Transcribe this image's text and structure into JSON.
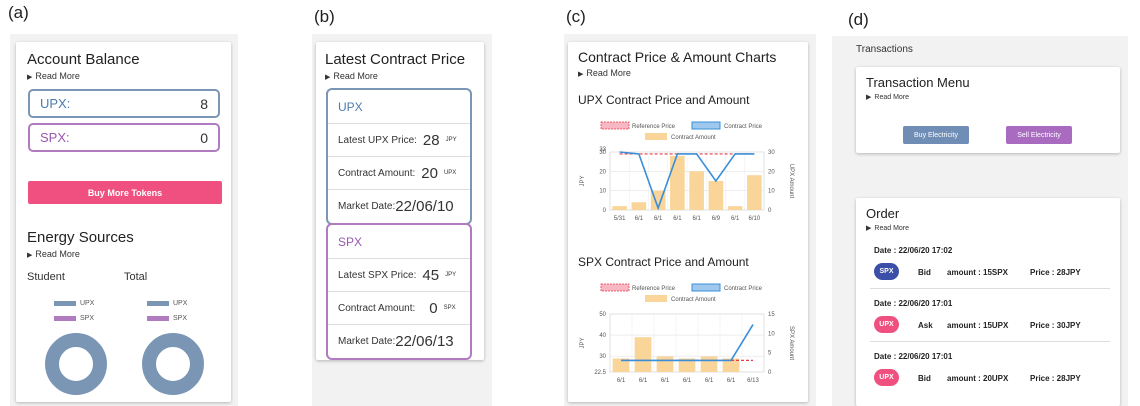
{
  "labels": {
    "a": "(a)",
    "b": "(b)",
    "c": "(c)",
    "d": "(d)"
  },
  "read_more": "Read More",
  "colors": {
    "upx": "#7b96b5",
    "spx": "#b07bc0",
    "pink": "#f0507f",
    "bar": "#f9d59a",
    "ref_line": "#e83a4a",
    "price_line": "#3a8fd8"
  },
  "panel_a": {
    "title": "Account Balance",
    "upx": {
      "name": "UPX:",
      "value": "8"
    },
    "spx": {
      "name": "SPX:",
      "value": "0"
    },
    "buy_button": "Buy More Tokens",
    "energy_title": "Energy Sources",
    "student_label": "Student",
    "total_label": "Total",
    "legend": {
      "upx": "UPX",
      "spx": "SPX"
    }
  },
  "panel_b": {
    "title": "Latest Contract Price",
    "upx": {
      "header": "UPX",
      "price_label": "Latest UPX Price:",
      "price_value": "28",
      "price_unit": "JPY",
      "amount_label": "Contract Amount:",
      "amount_value": "20",
      "amount_unit": "UPX",
      "date_label": "Market Date:",
      "date_value": "22/06/10"
    },
    "spx": {
      "header": "SPX",
      "price_label": "Latest SPX Price:",
      "price_value": "45",
      "price_unit": "JPY",
      "amount_label": "Contract Amount:",
      "amount_value": "0",
      "amount_unit": "SPX",
      "date_label": "Market Date:",
      "date_value": "22/06/13"
    }
  },
  "panel_c": {
    "title": "Contract Price & Amount Charts",
    "upx_chart_title": "UPX Contract Price and Amount",
    "spx_chart_title": "SPX Contract Price and Amount"
  },
  "chart_data": [
    {
      "type": "bar",
      "title": "UPX Contract Price and Amount",
      "categories": [
        "5/31",
        "6/1",
        "6/1",
        "6/1",
        "6/1",
        "6/9",
        "6/1",
        "6/10"
      ],
      "ylabel": "JPY",
      "y2label": "UPX Amount",
      "ylim": [
        0,
        30
      ],
      "y2lim": [
        0,
        30
      ],
      "yticks": [
        "0",
        "10",
        "20",
        "30",
        "33"
      ],
      "y2ticks": [
        "0",
        "10",
        "20",
        "30"
      ],
      "legend": [
        "Reference Price",
        "Contract Price",
        "Contract Amount"
      ],
      "legend_position": "top",
      "grid": true,
      "series": [
        {
          "name": "Contract Amount",
          "kind": "bar",
          "axis": "right",
          "values": [
            2,
            4,
            10,
            28,
            20,
            15,
            2,
            18
          ]
        },
        {
          "name": "Contract Price",
          "kind": "line",
          "axis": "left",
          "values": [
            30,
            29,
            1,
            29,
            29,
            15,
            29,
            29
          ]
        },
        {
          "name": "Reference Price",
          "kind": "dashed",
          "axis": "left",
          "values": [
            29,
            29,
            29,
            29,
            29,
            29,
            29,
            29
          ]
        }
      ]
    },
    {
      "type": "bar",
      "title": "SPX Contract Price and Amount",
      "categories": [
        "6/1",
        "6/1",
        "6/1",
        "6/1",
        "6/1",
        "6/1",
        "6/13"
      ],
      "ylabel": "JPY",
      "y2label": "SPX Amount",
      "ylim": [
        22.5,
        50
      ],
      "y2lim": [
        0,
        15
      ],
      "yticks": [
        "22.5",
        "30",
        "40",
        "50"
      ],
      "y2ticks": [
        "0",
        "5",
        "10",
        "15"
      ],
      "legend": [
        "Reference Price",
        "Contract Price",
        "Contract Amount"
      ],
      "legend_position": "top",
      "grid": true,
      "series": [
        {
          "name": "Contract Amount",
          "kind": "bar",
          "axis": "right",
          "values": [
            3.5,
            9,
            4,
            3.5,
            4,
            3.5,
            0
          ]
        },
        {
          "name": "Contract Price",
          "kind": "line",
          "axis": "left",
          "values": [
            28,
            28,
            28,
            28,
            28,
            28,
            45
          ]
        },
        {
          "name": "Reference Price",
          "kind": "dashed",
          "axis": "left",
          "values": [
            28,
            28,
            28,
            28,
            28,
            28,
            28
          ]
        }
      ]
    }
  ],
  "panel_d": {
    "header": "Transactions",
    "menu_title": "Transaction Menu",
    "buy_button": "Buy Electricity",
    "sell_button": "Sell Electricity",
    "order_title": "Order",
    "orders": [
      {
        "date": "Date : 22/06/20 17:02",
        "token": "SPX",
        "side": "Bid",
        "amount": "amount : 15SPX",
        "price": "Price : 28JPY",
        "color": "#3b4fa8"
      },
      {
        "date": "Date : 22/06/20 17:01",
        "token": "UPX",
        "side": "Ask",
        "amount": "amount : 15UPX",
        "price": "Price : 30JPY",
        "color": "#f0507f"
      },
      {
        "date": "Date : 22/06/20 17:01",
        "token": "UPX",
        "side": "Bid",
        "amount": "amount : 20UPX",
        "price": "Price : 28JPY",
        "color": "#f0507f"
      }
    ]
  }
}
